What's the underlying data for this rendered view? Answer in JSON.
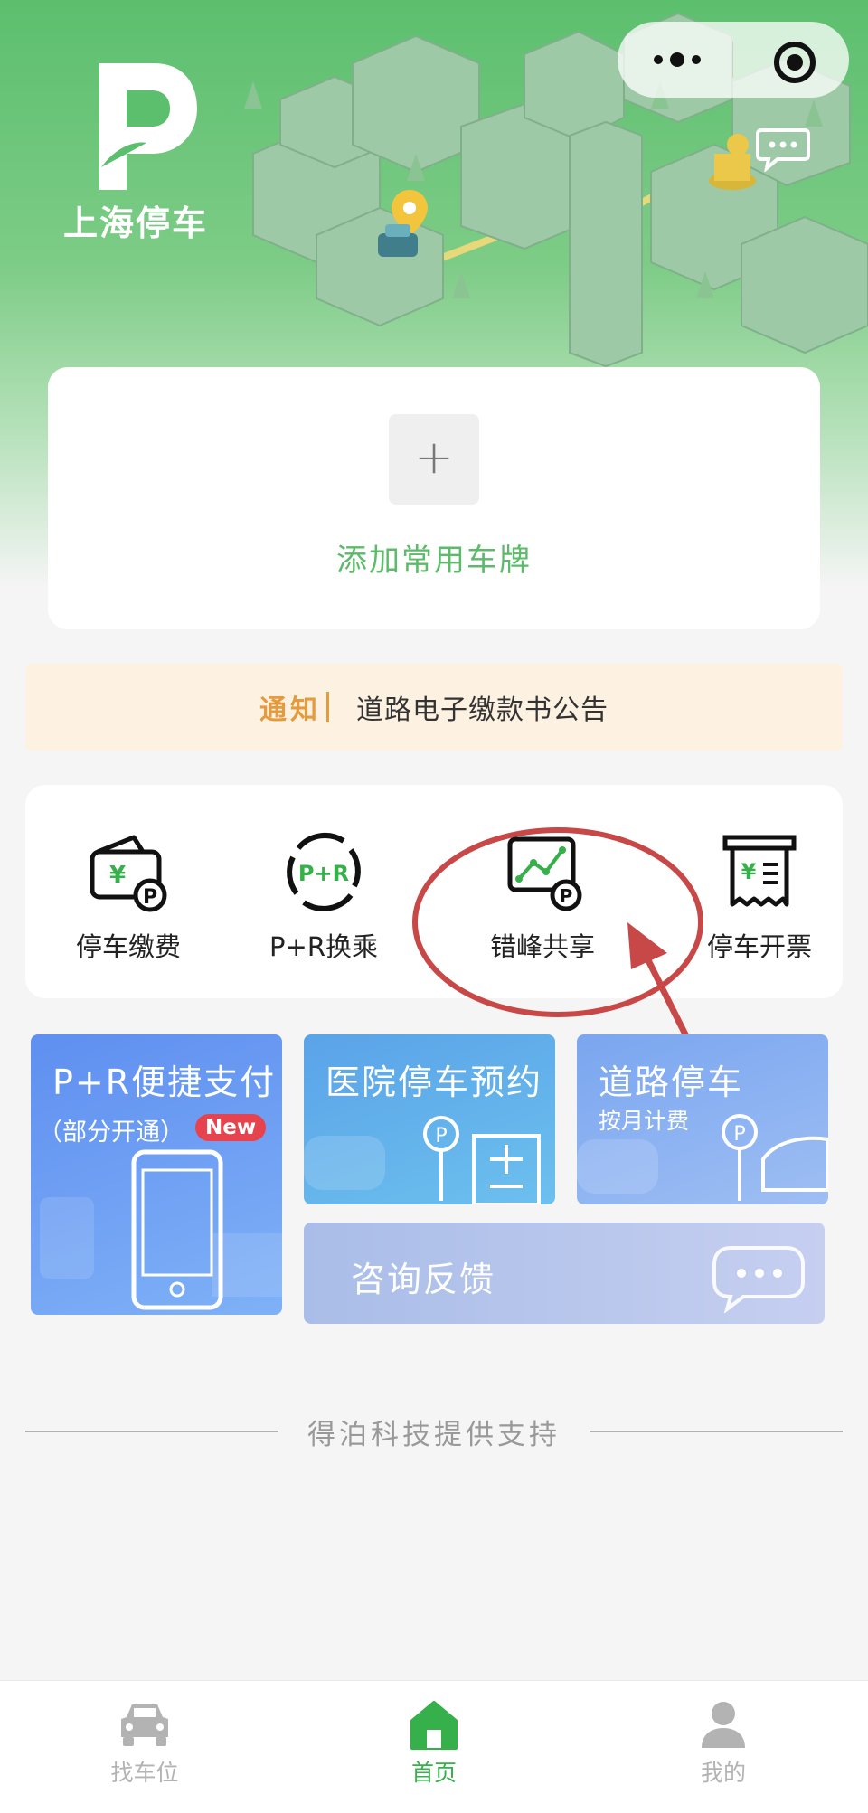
{
  "app": {
    "logo_text": "上海停车"
  },
  "plate": {
    "add_symbol": "+",
    "add_label": "添加常用车牌"
  },
  "notice": {
    "tag": "通知",
    "text": "道路电子缴款书公告"
  },
  "services": [
    {
      "label": "停车缴费",
      "icon": "wallet-parking-icon"
    },
    {
      "label": "P+R换乘",
      "icon": "park-and-ride-icon"
    },
    {
      "label": "错峰共享",
      "icon": "chart-parking-icon"
    },
    {
      "label": "停车开票",
      "icon": "invoice-icon"
    }
  ],
  "tiles": {
    "pr_pay": {
      "title": "P+R便捷支付",
      "subtitle": "（部分开通）",
      "badge": "New"
    },
    "hospital": {
      "title": "医院停车预约"
    },
    "road": {
      "title": "道路停车",
      "subtitle": "按月计费"
    },
    "feedback": {
      "title": "咨询反馈"
    }
  },
  "footer": {
    "support": "得泊科技提供支持"
  },
  "tabbar": {
    "items": [
      {
        "label": "找车位",
        "icon": "car-icon"
      },
      {
        "label": "首页",
        "icon": "home-icon",
        "active": true
      },
      {
        "label": "我的",
        "icon": "user-icon"
      }
    ]
  },
  "colors": {
    "brand_green": "#5cbb69",
    "notice_orange": "#e59b3d",
    "annotation_red": "#c84848",
    "new_badge": "#e7434f"
  }
}
